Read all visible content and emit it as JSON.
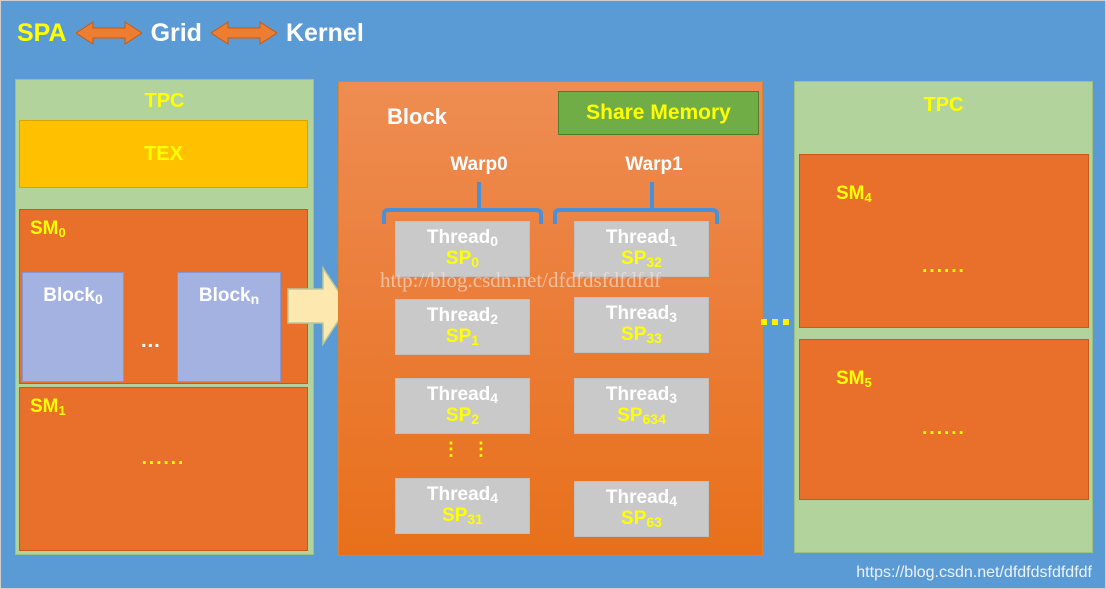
{
  "header": {
    "spa": "SPA",
    "grid": "Grid",
    "kernel": "Kernel",
    "arrow_icon": "double-headed-arrow"
  },
  "left_panel": {
    "tpc_label": "TPC",
    "tex_label": "TEX",
    "sm0": {
      "label": "SM",
      "index": "0",
      "blocks": [
        {
          "label": "Block",
          "index": "0"
        },
        {
          "label": "Block",
          "index": "n"
        }
      ],
      "ellipsis": "..."
    },
    "sm1": {
      "label": "SM",
      "index": "1",
      "dots": "......"
    }
  },
  "center_panel": {
    "title": "Block",
    "share_memory": "Share Memory",
    "warps": [
      {
        "label": "Warp0"
      },
      {
        "label": "Warp1"
      }
    ],
    "vertical_dots": "⋮",
    "threads_left": [
      {
        "name": "Thread",
        "name_sub": "0",
        "sp": "SP",
        "sp_sub": "0"
      },
      {
        "name": "Thread",
        "name_sub": "2",
        "sp": "SP",
        "sp_sub": "1"
      },
      {
        "name": "Thread",
        "name_sub": "4",
        "sp": "SP",
        "sp_sub": "2"
      },
      {
        "name": "Thread",
        "name_sub": "4",
        "sp": "SP",
        "sp_sub": "31"
      }
    ],
    "threads_right": [
      {
        "name": "Thread",
        "name_sub": "1",
        "sp": "SP",
        "sp_sub": "32"
      },
      {
        "name": "Thread",
        "name_sub": "3",
        "sp": "SP",
        "sp_sub": "33"
      },
      {
        "name": "Thread",
        "name_sub": "3",
        "sp": "SP",
        "sp_sub": "634"
      },
      {
        "name": "Thread",
        "name_sub": "4",
        "sp": "SP",
        "sp_sub": "63"
      }
    ]
  },
  "right_panel": {
    "tpc_label": "TPC",
    "sm4": {
      "label": "SM",
      "index": "4",
      "dots": "......"
    },
    "sm5": {
      "label": "SM",
      "index": "5",
      "dots": "......"
    }
  },
  "connectors": {
    "big_arrow_icon": "right-block-arrow",
    "mid_dots_icon": "horizontal-dotted-connector"
  },
  "watermarks": {
    "center": "http://blog.csdn.net/dfdfdsfdfdfdf",
    "bottom": "https://blog.csdn.net/dfdfdsfdfdfdf"
  },
  "colors": {
    "background_blue": "#5B9BD5",
    "tpc_green": "#B3D39C",
    "tex_gold": "#FFC000",
    "sm_orange": "#E8702A",
    "block_periwinkle": "#A3B2E0",
    "share_memory_green": "#70AD47",
    "thread_grey": "#C9C9C9",
    "accent_yellow": "#FFFF00",
    "arrow_orange": "#ED7D31",
    "big_arrow_cream": "#FDE9B0",
    "bracket_blue": "#4A90D9"
  }
}
